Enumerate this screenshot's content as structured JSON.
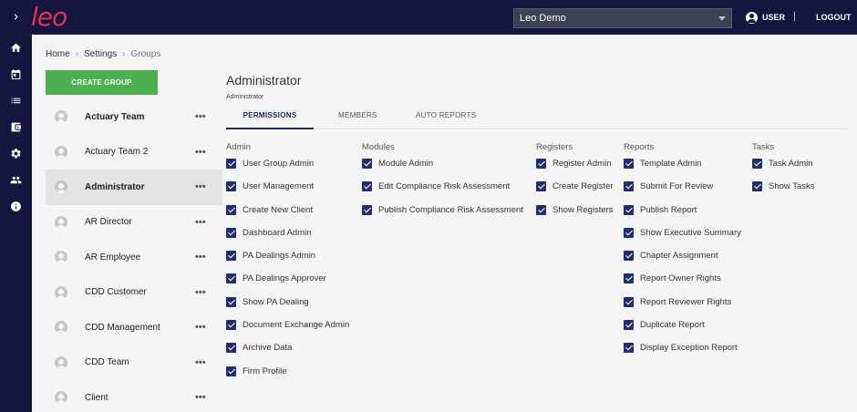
{
  "app": {
    "logo": "leo"
  },
  "topbar": {
    "org_select": "Leo Demo",
    "user_label": "USER",
    "logout_label": "LOGOUT"
  },
  "rail": {
    "items": [
      "expand-icon",
      "home-icon",
      "calendar-icon",
      "list-icon",
      "wallet-icon",
      "gear-icon",
      "people-icon",
      "info-icon"
    ]
  },
  "breadcrumb": {
    "home": "Home",
    "settings": "Settings",
    "current": "Groups"
  },
  "create_group_label": "CREATE GROUP",
  "groups": [
    {
      "name": "Actuary Team",
      "bold": true
    },
    {
      "name": "Actuary Team 2",
      "bold": false
    },
    {
      "name": "Administrator",
      "bold": true,
      "active": true
    },
    {
      "name": "AR Director",
      "bold": false
    },
    {
      "name": "AR Employee",
      "bold": false
    },
    {
      "name": "CDD Customer",
      "bold": false
    },
    {
      "name": "CDD Management",
      "bold": false
    },
    {
      "name": "CDD Team",
      "bold": false
    },
    {
      "name": "Client",
      "bold": false
    }
  ],
  "group_more": "•••",
  "main": {
    "title": "Administrator",
    "subtitle": "Administrator",
    "tabs": [
      "PERMISSIONS",
      "MEMBERS",
      "AUTO REPORTS"
    ]
  },
  "permissions": {
    "admin": {
      "heading": "Admin",
      "items": [
        "User Group Admin",
        "User Management",
        "Create New Client",
        "Dashboard Admin",
        "PA Dealings Admin",
        "PA Dealings Approver",
        "Show PA Dealing",
        "Document Exchange Admin",
        "Archive Data",
        "Firm Profile"
      ]
    },
    "modules": {
      "heading": "Modules",
      "items": [
        "Module Admin",
        "Edit Compliance Risk Assessment",
        "Publish Compliance Risk Assessment"
      ]
    },
    "registers": {
      "heading": "Registers",
      "items": [
        "Register Admin",
        "Create Register",
        "Show Registers"
      ]
    },
    "reports": {
      "heading": "Reports",
      "items": [
        "Template Admin",
        "Submit For Review",
        "Publish Report",
        "Show Executive Summary",
        "Chapter Assignment",
        "Report Owner Rights",
        "Report Reviewer Rights",
        "Duplicate Report",
        "Display Exception Report"
      ]
    },
    "tasks": {
      "heading": "Tasks",
      "items": [
        "Task Admin",
        "Show Tasks"
      ]
    }
  },
  "colors": {
    "nav_bg": "#14163f",
    "accent": "#1f2f6f",
    "create_button": "#4caf50",
    "logo": "#e3324f"
  }
}
